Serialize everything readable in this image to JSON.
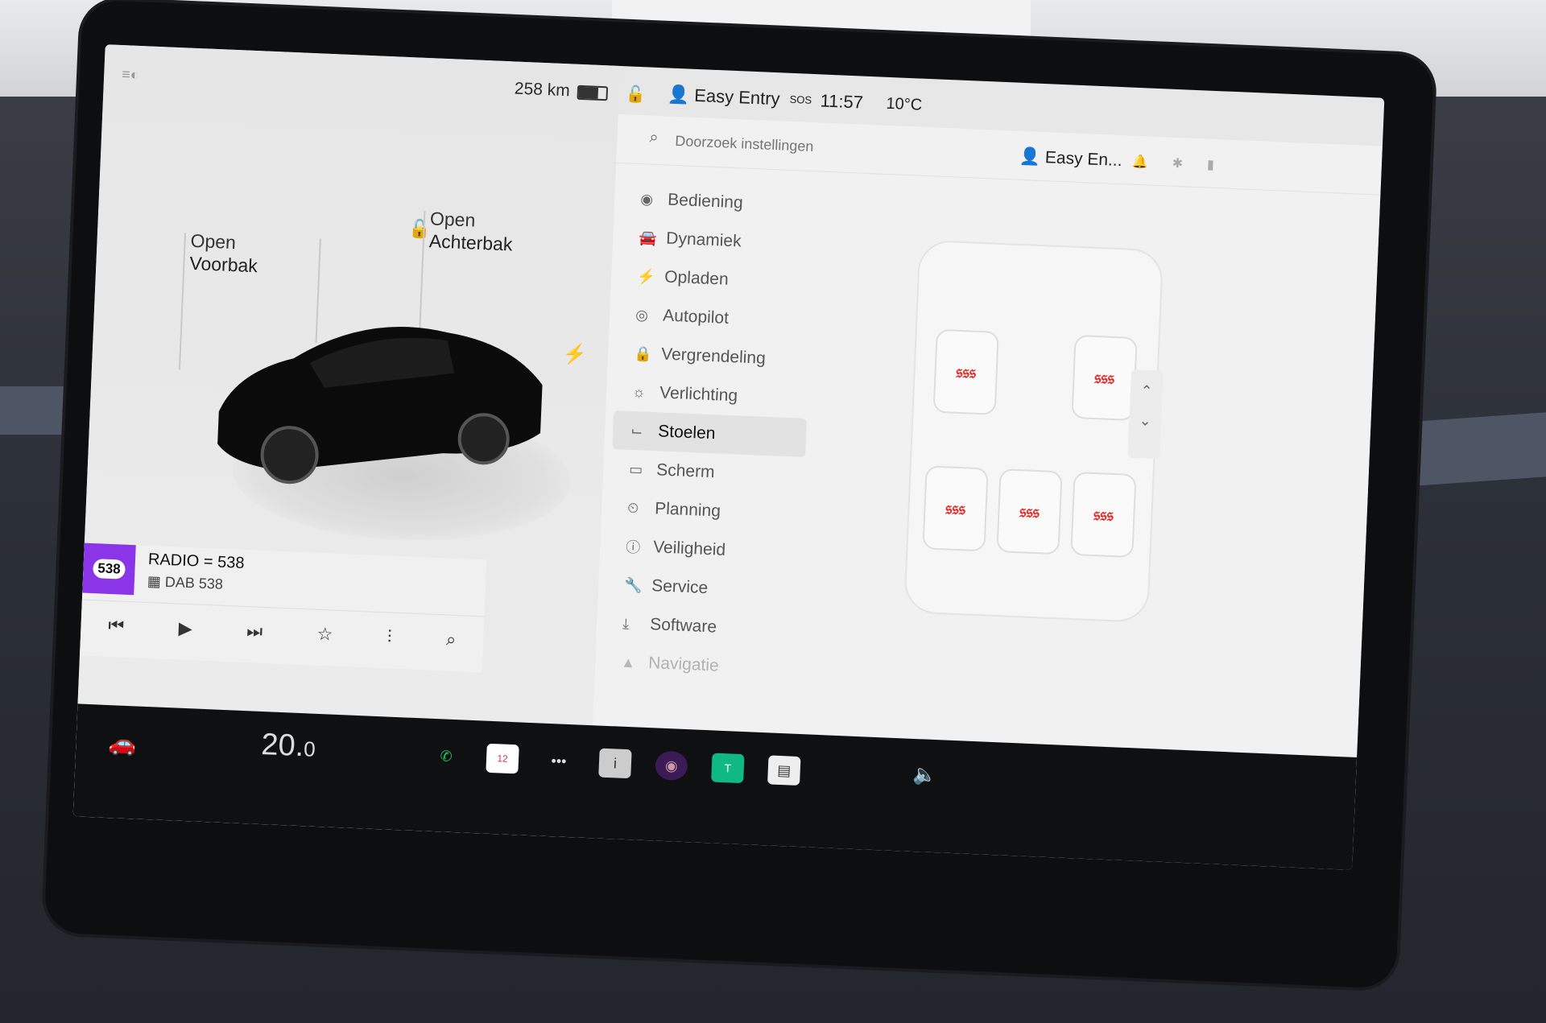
{
  "status": {
    "range": "258 km",
    "battery_level": 0.7,
    "profile": "Easy Entry",
    "sos": "SOS",
    "time": "11:57",
    "temperature": "10°C"
  },
  "car_view": {
    "front_trunk_line1": "Open",
    "front_trunk_line2": "Voorbak",
    "rear_trunk_line1": "Open",
    "rear_trunk_line2": "Achterbak"
  },
  "media": {
    "logo": "538",
    "title": "RADIO = 538",
    "subtitle": "DAB 538"
  },
  "settings": {
    "search_placeholder": "Doorzoek instellingen",
    "profile": "Easy En...",
    "menu": [
      {
        "label": "Bediening",
        "icon": "toggle-icon"
      },
      {
        "label": "Dynamiek",
        "icon": "car-icon"
      },
      {
        "label": "Opladen",
        "icon": "bolt-icon"
      },
      {
        "label": "Autopilot",
        "icon": "steering-wheel-icon"
      },
      {
        "label": "Vergrendeling",
        "icon": "lock-icon"
      },
      {
        "label": "Verlichting",
        "icon": "sun-icon"
      },
      {
        "label": "Stoelen",
        "icon": "seat-icon"
      },
      {
        "label": "Scherm",
        "icon": "screen-icon"
      },
      {
        "label": "Planning",
        "icon": "alarm-icon"
      },
      {
        "label": "Veiligheid",
        "icon": "warning-icon"
      },
      {
        "label": "Service",
        "icon": "wrench-icon"
      },
      {
        "label": "Software",
        "icon": "download-icon"
      },
      {
        "label": "Navigatie",
        "icon": "navigation-icon"
      }
    ],
    "active_item": "Stoelen"
  },
  "dock": {
    "temp_int": "20.",
    "temp_dec": "0",
    "calendar_day": "12"
  }
}
